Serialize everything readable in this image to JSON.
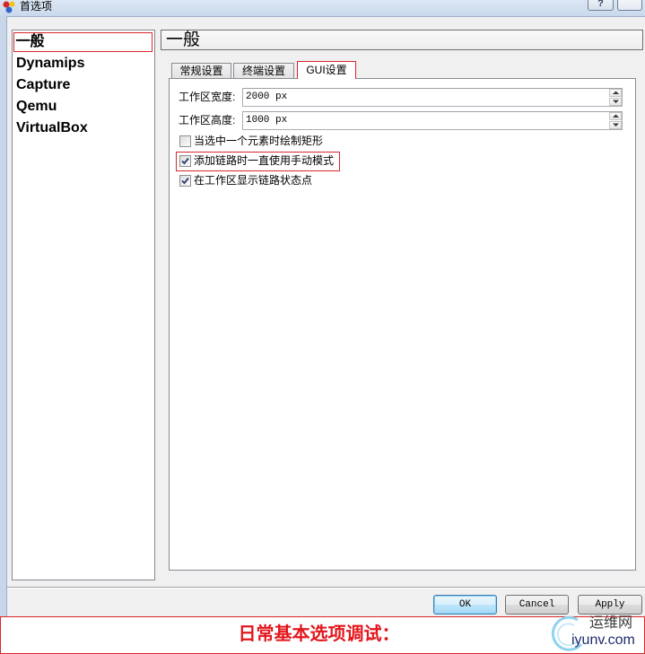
{
  "window": {
    "title": "首选项",
    "help_label": "?"
  },
  "sidebar": {
    "items": [
      {
        "label": "一般",
        "selected": true
      },
      {
        "label": "Dynamips",
        "selected": false
      },
      {
        "label": "Capture",
        "selected": false
      },
      {
        "label": "Qemu",
        "selected": false
      },
      {
        "label": "VirtualBox",
        "selected": false
      }
    ]
  },
  "section": {
    "title": "一般"
  },
  "tabs": [
    {
      "label": "常规设置",
      "active": false
    },
    {
      "label": "终端设置",
      "active": false
    },
    {
      "label": "GUI设置",
      "active": true
    }
  ],
  "gui_settings": {
    "scene_width": {
      "label": "工作区宽度:",
      "value": "2000 px"
    },
    "scene_height": {
      "label": "工作区高度:",
      "value": "1000 px"
    },
    "options": [
      {
        "label": "当选中一个元素时绘制矩形",
        "checked": false,
        "highlighted": false
      },
      {
        "label": "添加链路时一直使用手动模式",
        "checked": true,
        "highlighted": true
      },
      {
        "label": "在工作区显示链路状态点",
        "checked": true,
        "highlighted": false
      }
    ]
  },
  "buttons": {
    "ok": "OK",
    "cancel": "Cancel",
    "apply": "Apply"
  },
  "caption": "日常基本选项调试：",
  "watermark": {
    "name": "运维网",
    "domain": "iyunv.com"
  },
  "colors": {
    "annotation_red": "#d9272b",
    "caption_red": "#e3161c",
    "focus_blue": "#3c7fb1",
    "watermark_ring": "#8fd3ef",
    "watermark_text": "#1e2c6e"
  }
}
